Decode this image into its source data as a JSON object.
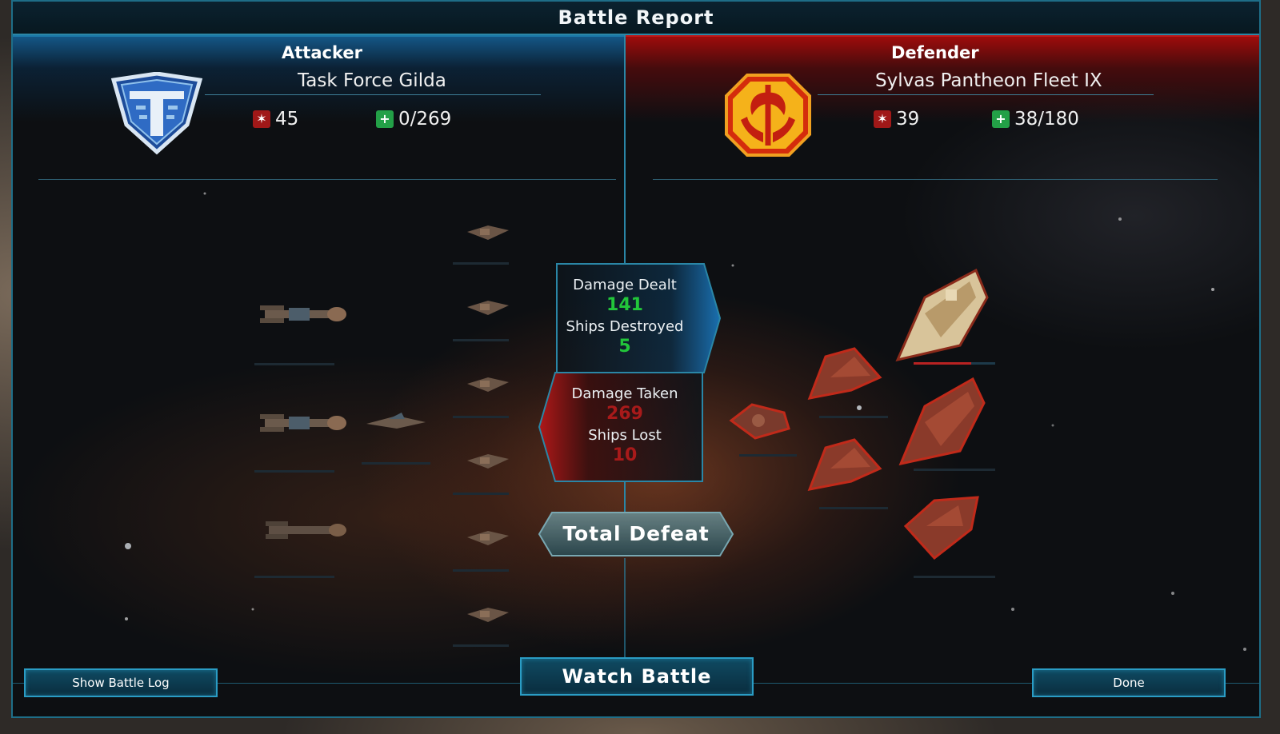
{
  "window": {
    "title": "Battle Report"
  },
  "attacker": {
    "side_label": "Attacker",
    "fleet_name": "Task Force Gilda",
    "power": "45",
    "hp": "0/269"
  },
  "defender": {
    "side_label": "Defender",
    "fleet_name": "Sylvas Pantheon Fleet IX",
    "power": "39",
    "hp": "38/180"
  },
  "summary": {
    "damage_dealt_label": "Damage Dealt",
    "damage_dealt": "141",
    "ships_destroyed_label": "Ships Destroyed",
    "ships_destroyed": "5",
    "damage_taken_label": "Damage Taken",
    "damage_taken": "269",
    "ships_lost_label": "Ships Lost",
    "ships_lost": "10"
  },
  "result": "Total Defeat",
  "buttons": {
    "show_log": "Show Battle Log",
    "watch": "Watch Battle",
    "done": "Done"
  },
  "colors": {
    "attacker": "#1b79a8",
    "defender": "#c01818",
    "positive": "#22c63a",
    "negative": "#a81a1a"
  },
  "icons": {
    "power": "fleet-power-icon",
    "hp": "health-plus-icon",
    "attacker_emblem": "terran-shield-emblem",
    "defender_emblem": "axe-crest-emblem"
  }
}
